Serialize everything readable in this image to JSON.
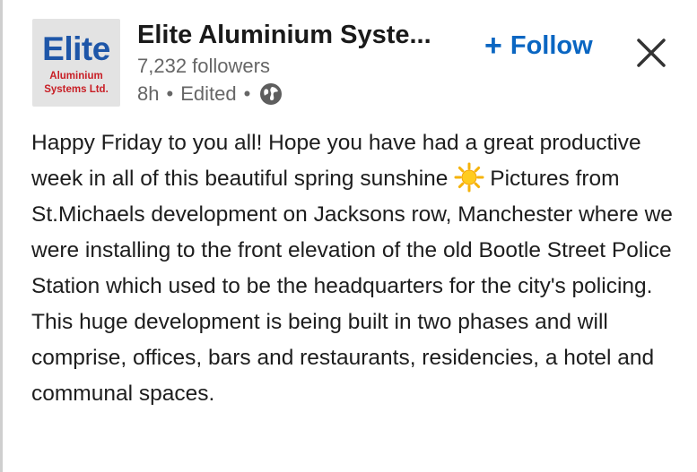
{
  "post": {
    "company": {
      "logo": {
        "word": "Elite",
        "line1": "Aluminium",
        "line2": "Systems Ltd."
      },
      "name": "Elite Aluminium Syste...",
      "followers": "7,232 followers",
      "time": "8h",
      "edited": "Edited",
      "separator": "•",
      "visibility_icon": "globe-icon"
    },
    "actions": {
      "follow_label": "Follow",
      "follow_icon": "+",
      "close_icon": "close-icon"
    },
    "body": {
      "before_emoji": "Happy Friday to you all! Hope you have had a great productive week in all of this beautiful spring sunshine",
      "emoji_icon": "sun-icon",
      "after_emoji": "Pictures from St.Michaels development on Jacksons row, Manchester where we were installing to the front elevation of the old Bootle Street Police Station which used to be the headquarters for the city's policing. This huge development is being built in two phases and will comprise, offices, bars and restaurants, residencies, a hotel and communal spaces."
    }
  },
  "colors": {
    "accent": "#0a66c2",
    "logo_blue": "#1e56a8",
    "logo_red": "#c81e25",
    "secondary_text": "#666666"
  }
}
